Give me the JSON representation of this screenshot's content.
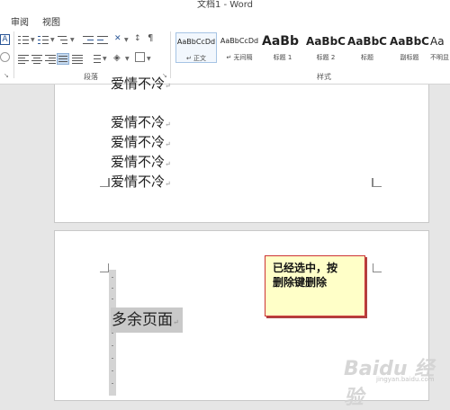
{
  "window": {
    "title": "文档1 - Word"
  },
  "menu": [
    "审阅",
    "视图"
  ],
  "ribbon": {
    "paragraph_group_label": "段落",
    "styles_group_label": "样式",
    "launcher_glyph": "↘",
    "font_box_glyph": "A",
    "styles": [
      {
        "sample": "AaBbCcDd",
        "name": "↵ 正文",
        "selected": true
      },
      {
        "sample": "AaBbCcDd",
        "name": "↵ 无间隔",
        "selected": false
      },
      {
        "sample": "AaBb",
        "name": "标题 1",
        "selected": false
      },
      {
        "sample": "AaBbC",
        "name": "标题 2",
        "selected": false
      },
      {
        "sample": "AaBbC",
        "name": "标题",
        "selected": false
      },
      {
        "sample": "AaBbC",
        "name": "副标题",
        "selected": false
      },
      {
        "sample": "Aa",
        "name": "不明显",
        "selected": false
      }
    ]
  },
  "document": {
    "page1_lines": [
      "爱情不冷",
      "爱情不冷",
      "爱情不冷",
      "爱情不冷",
      "爱情不冷"
    ],
    "paragraph_mark": "↵",
    "page2_selected_text": "多余页面"
  },
  "callout": {
    "line1": "已经选中，按",
    "line2": "删除键删除"
  },
  "watermark": {
    "text": "Baidu 经验",
    "sub": "jingyan.baidu.com"
  },
  "colors": {
    "selection": "#c9c9c9",
    "callout_bg": "#ffffc8",
    "callout_border": "#cc3333"
  }
}
